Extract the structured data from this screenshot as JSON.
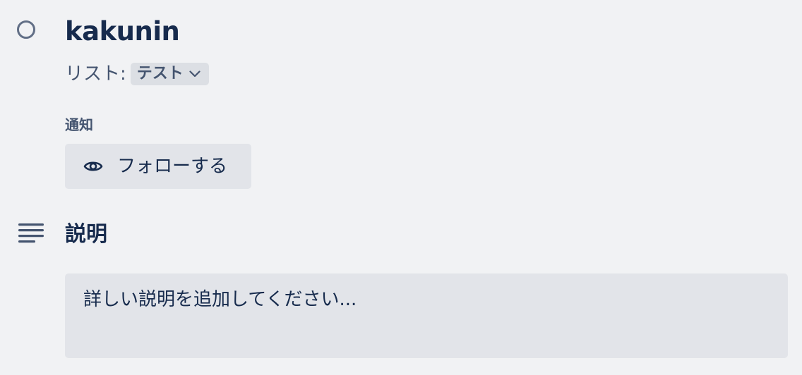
{
  "card": {
    "title": "kakunin",
    "list_label": "リスト:",
    "list_value": "テスト"
  },
  "notifications": {
    "label": "通知",
    "follow_label": "フォローする"
  },
  "description": {
    "heading": "説明",
    "placeholder": "詳しい説明を追加してください..."
  },
  "icons": {
    "complete": "circle-outline-icon",
    "list_dropdown": "chevron-down-icon",
    "follow": "eye-icon",
    "description": "text-lines-icon"
  },
  "colors": {
    "background": "#f1f2f4",
    "text_primary": "#172b4d",
    "text_secondary": "#44546f",
    "button_bg": "#e2e4e9",
    "select_bg": "#dcdfe4",
    "icon_gray": "#626f86"
  }
}
